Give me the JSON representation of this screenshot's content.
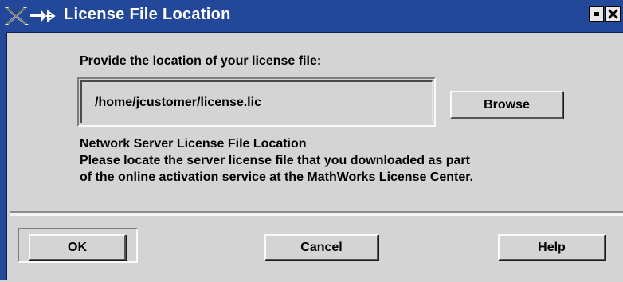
{
  "window": {
    "title": "License File Location"
  },
  "icons": {
    "app_logo": "x-window-logo-icon",
    "pin": "pin-icon",
    "minimize": "minimize-icon",
    "close": "close-icon"
  },
  "colors": {
    "titlebar": "#23489a",
    "background": "#d4d4d4"
  },
  "main": {
    "prompt": "Provide the location of your license file:",
    "path_value": "/home/jcustomer/license.lic",
    "browse_label": "Browse",
    "info": {
      "heading": "Network Server License File Location",
      "line1": "Please locate the server license file that you downloaded as part",
      "line2": "of the online activation service at the MathWorks License Center."
    }
  },
  "footer": {
    "ok_label": "OK",
    "cancel_label": "Cancel",
    "help_label": "Help"
  }
}
